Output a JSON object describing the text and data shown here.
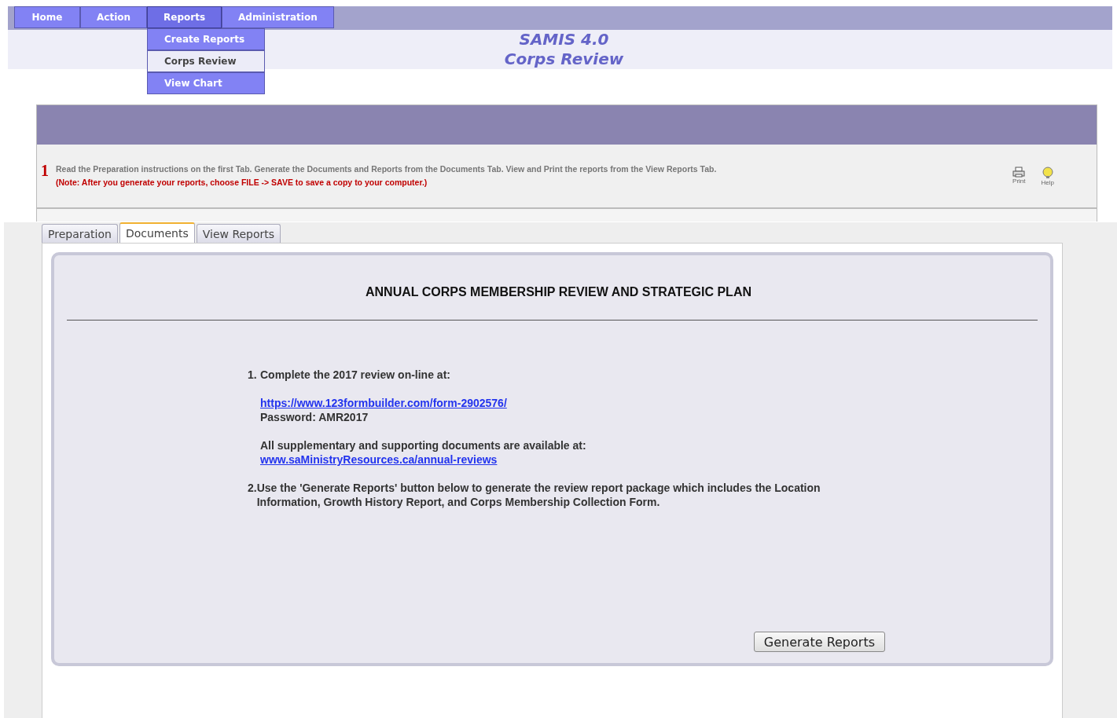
{
  "nav": {
    "items": [
      {
        "label": "Home",
        "selected": false
      },
      {
        "label": "Action",
        "selected": false
      },
      {
        "label": "Reports",
        "selected": true
      },
      {
        "label": "Administration",
        "selected": false
      }
    ]
  },
  "dropdown": {
    "items": [
      {
        "label": "Create Reports",
        "selected": false
      },
      {
        "label": "Corps Review",
        "selected": true
      },
      {
        "label": "View Chart",
        "selected": false
      }
    ]
  },
  "header": {
    "title": "SAMIS 4.0",
    "subtitle": "Corps Review"
  },
  "instructions": {
    "text": "Read the Preparation instructions on the first Tab. Generate the Documents and Reports from the Documents Tab. View and Print the reports from the View Reports Tab.",
    "note": "(Note: After you generate your reports, choose FILE -> SAVE to save a copy to your computer.)"
  },
  "tools": [
    {
      "label": "Print",
      "kind": "print"
    },
    {
      "label": "Help",
      "kind": "help"
    }
  ],
  "tabs": [
    {
      "label": "Preparation",
      "selected": false
    },
    {
      "label": "Documents",
      "selected": true
    },
    {
      "label": "View Reports",
      "selected": false
    }
  ],
  "document": {
    "heading": "ANNUAL CORPS MEMBERSHIP REVIEW AND STRATEGIC PLAN",
    "steps": [
      {
        "number": "1.",
        "text": "Complete the 2017 review on-line at:",
        "link": "https://www.123formbuilder.com/form-2902576/",
        "password": "Password: AMR2017",
        "extra": "All supplementary and supporting documents are available at:",
        "extra_link": "www.saMinistryResources.ca/annual-reviews"
      },
      {
        "number": "2.",
        "text": "Use the 'Generate Reports' button below to generate the review report package which includes the Location Information, Growth History Report, and Corps Membership Collection Form."
      }
    ],
    "button": "Generate Reports"
  },
  "callout_label": "1"
}
